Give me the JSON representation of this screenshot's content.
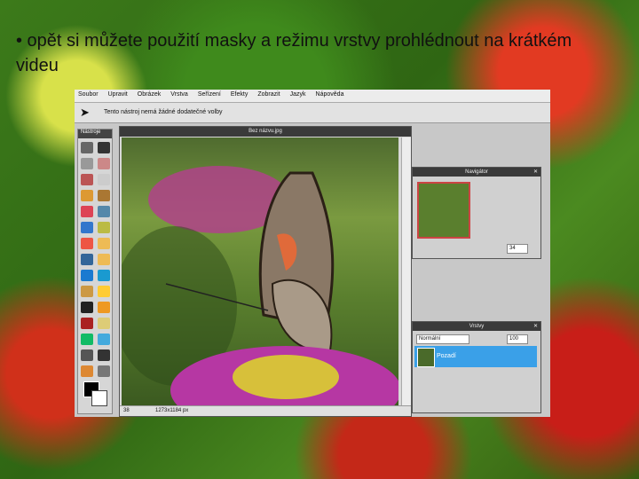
{
  "slide": {
    "bullet_text": "• opět si můžete použití masky a režimu vrstvy prohlédnout na krátkém videu"
  },
  "app": {
    "menu": [
      "Soubor",
      "Upravit",
      "Obrázek",
      "Vrstva",
      "Seřízení",
      "Efekty",
      "Zobrazit",
      "Jazyk",
      "Nápověda"
    ],
    "options_hint": "Tento nástroj nemá žádné dodatečné volby",
    "toolbox_title": "Nástroje",
    "image_title": "Bez názvu.jpg",
    "zoom_value": "38",
    "nav_title": "Navigátor",
    "nav_zoom": "34",
    "layers_title": "Vrstvy",
    "layer_mode": "Normální",
    "layer_opacity": "100",
    "layer_name": "Pozadí",
    "status_left": "38",
    "status_mid": "1273x1184 px"
  },
  "colors": {
    "accent": "#3aa0e8",
    "panel_header": "#3a3a3a"
  }
}
